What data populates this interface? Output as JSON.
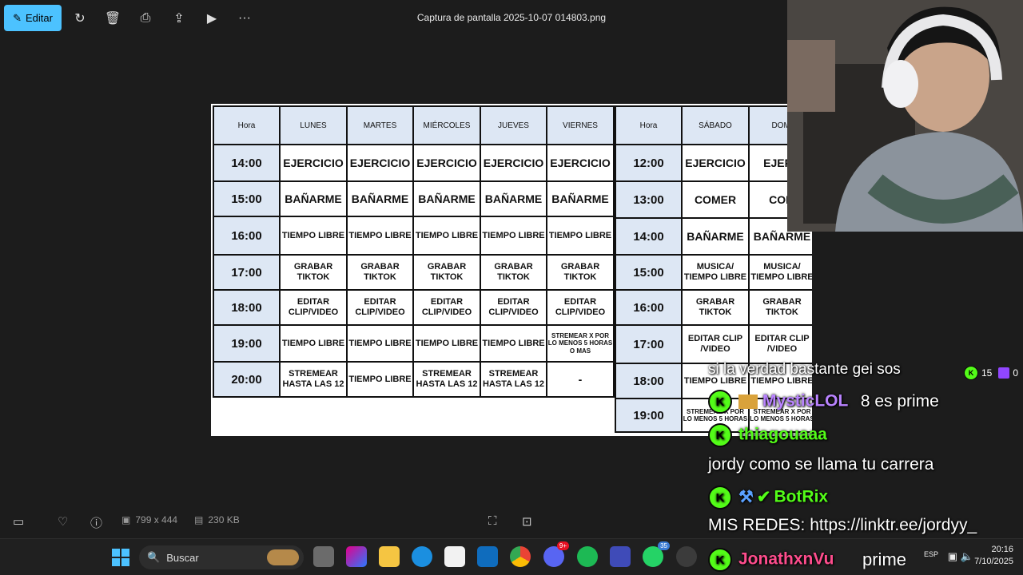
{
  "toolbar": {
    "edit_label": "Editar",
    "file_title": "Captura de pantalla 2025-10-07 014803.png",
    "more_label": "···"
  },
  "schedule_left": {
    "headers": [
      "Hora",
      "LUNES",
      "MARTES",
      "MIÉRCOLES",
      "JUEVES",
      "VIERNES"
    ],
    "rows": [
      {
        "hour": "14:00",
        "cells": [
          "EJERCICIO",
          "EJERCICIO",
          "EJERCICIO",
          "EJERCICIO",
          "EJERCICIO"
        ]
      },
      {
        "hour": "15:00",
        "cells": [
          "BAÑARME",
          "BAÑARME",
          "BAÑARME",
          "BAÑARME",
          "BAÑARME"
        ]
      },
      {
        "hour": "16:00",
        "cells": [
          "TIEMPO LIBRE",
          "TIEMPO LIBRE",
          "TIEMPO LIBRE",
          "TIEMPO LIBRE",
          "TIEMPO LIBRE"
        ]
      },
      {
        "hour": "17:00",
        "cells": [
          "GRABAR TIKTOK",
          "GRABAR TIKTOK",
          "GRABAR TIKTOK",
          "GRABAR TIKTOK",
          "GRABAR TIKTOK"
        ]
      },
      {
        "hour": "18:00",
        "cells": [
          "EDITAR CLIP/VIDEO",
          "EDITAR CLIP/VIDEO",
          "EDITAR CLIP/VIDEO",
          "EDITAR CLIP/VIDEO",
          "EDITAR CLIP/VIDEO"
        ]
      },
      {
        "hour": "19:00",
        "cells": [
          "TIEMPO LIBRE",
          "TIEMPO LIBRE",
          "TIEMPO LIBRE",
          "TIEMPO LIBRE",
          "STREMEAR X POR LO MENOS 5 HORAS O MAS"
        ]
      },
      {
        "hour": "20:00",
        "cells": [
          "STREMEAR HASTA LAS 12",
          "TIEMPO LIBRE",
          "STREMEAR HASTA LAS 12",
          "STREMEAR HASTA LAS 12",
          "-"
        ]
      }
    ]
  },
  "schedule_right": {
    "headers": [
      "Hora",
      "SÁBADO",
      "DOMI"
    ],
    "rows": [
      {
        "hour": "12:00",
        "cells": [
          "EJERCICIO",
          "EJERC"
        ]
      },
      {
        "hour": "13:00",
        "cells": [
          "COMER",
          "COM"
        ]
      },
      {
        "hour": "14:00",
        "cells": [
          "BAÑARME",
          "BAÑARME"
        ]
      },
      {
        "hour": "15:00",
        "cells": [
          "MUSICA/ TIEMPO LIBRE",
          "MUSICA/ TIEMPO LIBRE"
        ]
      },
      {
        "hour": "16:00",
        "cells": [
          "GRABAR TIKTOK",
          "GRABAR TIKTOK"
        ]
      },
      {
        "hour": "17:00",
        "cells": [
          "EDITAR CLIP /VIDEO",
          "EDITAR CLIP /VIDEO"
        ]
      },
      {
        "hour": "18:00",
        "cells": [
          "TIEMPO LIBRE",
          "TIEMPO LIBRE"
        ]
      },
      {
        "hour": "19:00",
        "cells": [
          "STREMEAR X POR LO MENOS 5 HORAS",
          "STREMEAR X POR LO MENOS 5 HORAS"
        ]
      }
    ]
  },
  "bottom": {
    "dimensions": "799 x 444",
    "size": "230 KB"
  },
  "taskbar": {
    "search_placeholder": "Buscar",
    "lang": "ESP",
    "time": "20:16",
    "date": "7/10/2025",
    "discord_badge": "9+",
    "whatsapp_badge": "35"
  },
  "chat": {
    "line1": "si la verdad bastante gei sos",
    "kick_count": "15",
    "twitch_count": "0",
    "user2": "MysticLOL",
    "msg2": "8 es prime",
    "user3": "thiagouaaa",
    "line4": "jordy como se llama tu carrera",
    "user5": "BotRix",
    "line6": "MIS REDES: https://linktr.ee/jordyy_",
    "user7": "JonathxnVu",
    "msg7": "prime"
  },
  "colors": {
    "accent": "#4cc2ff",
    "kick_green": "#53fc18",
    "header_blue": "#dde7f4"
  }
}
